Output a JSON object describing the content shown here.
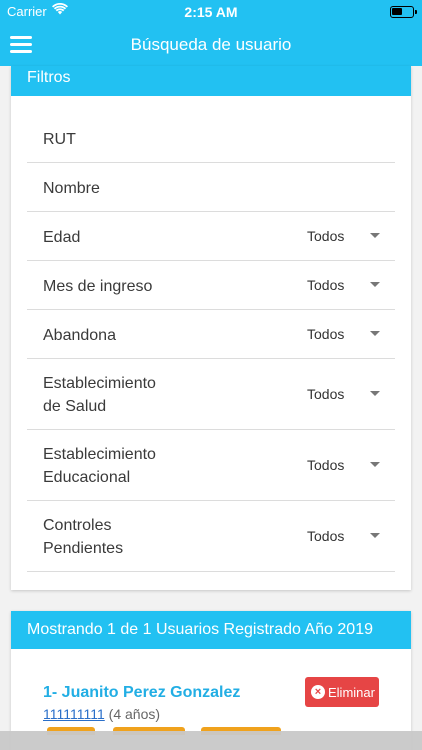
{
  "status_bar": {
    "carrier": "Carrier",
    "time": "2:15 AM"
  },
  "nav": {
    "title": "Búsqueda de usuario"
  },
  "filters": {
    "header": "Filtros",
    "fields": [
      {
        "label": "RUT"
      },
      {
        "label": "Nombre"
      },
      {
        "label": "Edad",
        "value": "Todos"
      },
      {
        "label": "Mes de ingreso",
        "value": "Todos"
      },
      {
        "label": "Abandona",
        "value": "Todos"
      },
      {
        "label_line1": "Establecimiento",
        "label_line2": "de Salud",
        "value": "Todos"
      },
      {
        "label_line1": "Establecimiento",
        "label_line2": "Educacional",
        "value": "Todos"
      },
      {
        "label_line1": "Controles",
        "label_line2": "Pendientes",
        "value": "Todos"
      }
    ]
  },
  "results": {
    "header": "Mostrando 1 de 1 Usuarios Registrado Año 2019",
    "user": {
      "name": "1- Juanito Perez Gonzalez",
      "rut": "111111111",
      "age": "(4 años)",
      "delete_label": "Eliminar"
    }
  },
  "colors": {
    "accent": "#22c1f2",
    "danger": "#e64545",
    "tag": "#f0a21c"
  },
  "icons": [
    "wifi-icon",
    "battery-icon",
    "menu-icon",
    "caret-down-icon",
    "close-circle-icon"
  ]
}
